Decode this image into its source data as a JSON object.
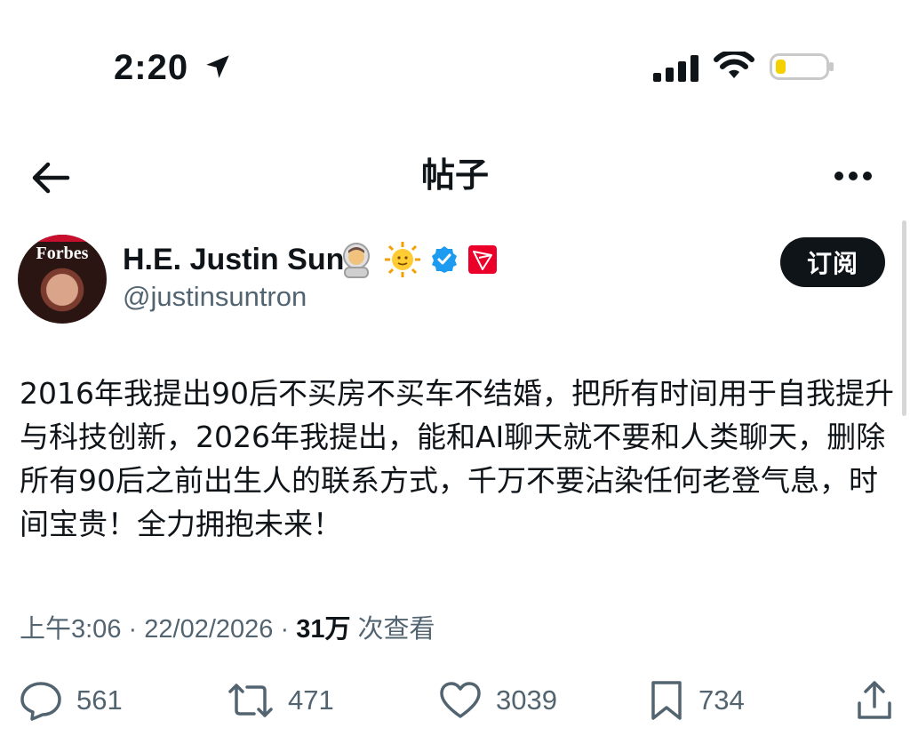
{
  "status_bar": {
    "time": "2:20",
    "icons": [
      "location-arrow-icon",
      "cellular-signal-icon",
      "wifi-icon",
      "battery-low-icon"
    ],
    "battery_color": "#f5d000"
  },
  "nav": {
    "title": "帖子",
    "back_icon": "arrow-left-icon",
    "more_icon": "more-horizontal-icon"
  },
  "author": {
    "display_name": "H.E. Justin Sun",
    "handle": "@justinsuntron",
    "avatar_brand_text": "Forbes",
    "badges": [
      "astronaut-emoji",
      "sun-face-emoji",
      "verified-badge-icon",
      "tron-logo-icon"
    ],
    "follow_label": "订阅"
  },
  "tweet": {
    "text": "2016年我提出90后不买房不买车不结婚，把所有时间用于自我提升与科技创新，2026年我提出，能和AI聊天就不要和人类聊天，删除所有90后之前出生人的联系方式，千万不要沾染任何老登气息，时间宝贵！全力拥抱未来！",
    "time": "上午3:06",
    "date": "22/02/2026",
    "separator": "·",
    "views_count": "31万",
    "views_label": "次查看"
  },
  "actions": {
    "replies": "561",
    "retweets": "471",
    "likes": "3039",
    "bookmarks": "734"
  },
  "colors": {
    "text_primary": "#0f1419",
    "text_secondary": "#536471",
    "verified_blue": "#1d9bf0",
    "tron_red": "#eb0029",
    "button_dark": "#0f1419"
  }
}
